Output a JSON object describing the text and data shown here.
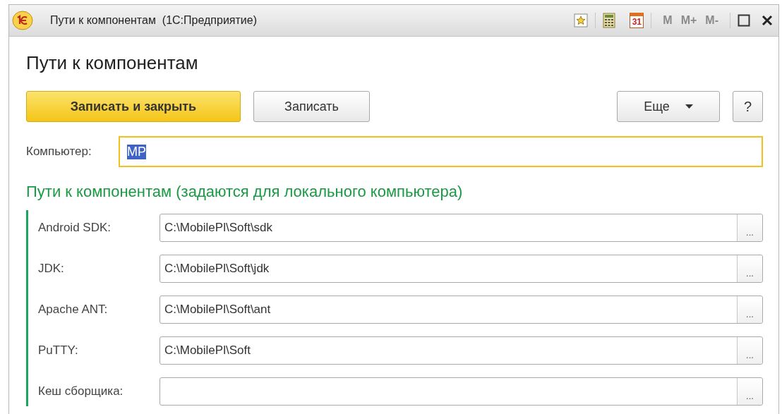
{
  "window": {
    "title": "Пути к компонентам  (1С:Предприятие)",
    "calendar_day": "31",
    "memory_buttons": [
      {
        "label": "M",
        "disabled": true
      },
      {
        "label": "M+",
        "disabled": true
      },
      {
        "label": "M-",
        "disabled": true
      }
    ]
  },
  "form": {
    "title": "Пути к компонентам",
    "buttons": [
      {
        "label": "Записать и закрыть",
        "kind": "primary"
      },
      {
        "label": "Записать",
        "kind": "normal"
      }
    ],
    "more_button": {
      "label": "Еще"
    },
    "help_button": {
      "label": "?"
    },
    "computer": {
      "label": "Компьютер:",
      "value": "MP",
      "focused": true,
      "value_selected": true
    },
    "group": {
      "title": "Пути к компонентам (задаются для локального компьютера)",
      "fields": [
        {
          "label": "Android SDK:",
          "value": "C:\\MobilePl\\Soft\\sdk",
          "button": "..."
        },
        {
          "label": "JDK:",
          "value": "C:\\MobilePl\\Soft\\jdk",
          "button": "..."
        },
        {
          "label": "Apache ANT:",
          "value": "C:\\MobilePl\\Soft\\ant",
          "button": "..."
        },
        {
          "label": "PuTTY:",
          "value": "C:\\MobilePl\\Soft",
          "button": "..."
        },
        {
          "label": "Кеш сборщика:",
          "button": "..."
        }
      ]
    }
  }
}
